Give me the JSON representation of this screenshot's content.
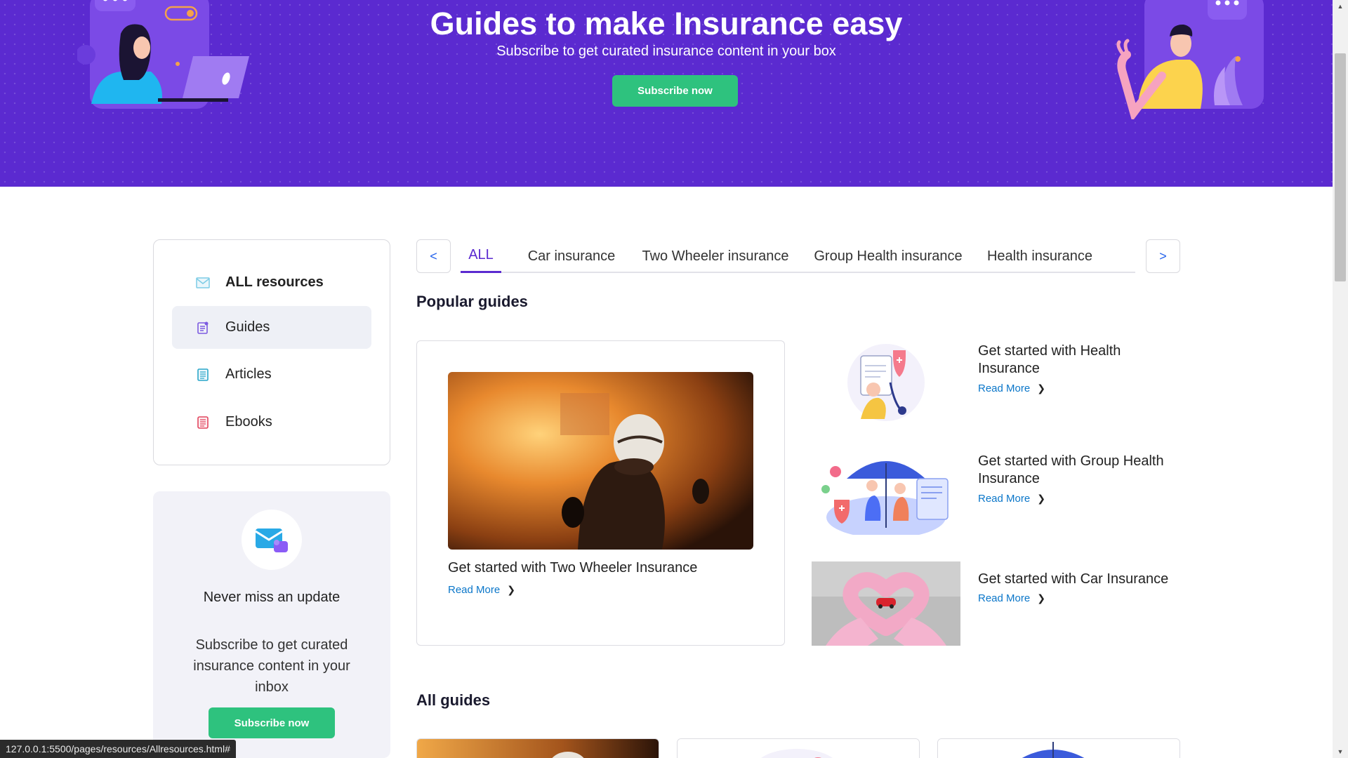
{
  "hero": {
    "title": "Guides to make Insurance easy",
    "subtitle": "Subscribe to get curated insurance content in your box",
    "subscribe_label": "Subscribe now"
  },
  "sidebar": {
    "items": [
      {
        "label": "ALL resources",
        "icon": "inbox-icon",
        "active": false
      },
      {
        "label": "Guides",
        "icon": "guide-icon",
        "active": true
      },
      {
        "label": "Articles",
        "icon": "article-icon",
        "active": false
      },
      {
        "label": "Ebooks",
        "icon": "ebook-icon",
        "active": false
      }
    ]
  },
  "subscribe_card": {
    "title": "Never miss an update",
    "text": "Subscribe to get curated insurance content in your inbox",
    "button_label": "Subscribe now"
  },
  "tabs": {
    "prev_label": "<",
    "next_label": ">",
    "items": [
      "ALL",
      "Car insurance",
      "Two Wheeler insurance",
      "Group Health insurance",
      "Health insurance"
    ],
    "active": "ALL"
  },
  "popular": {
    "heading": "Popular guides",
    "featured": {
      "title": "Get started with Two Wheeler Insurance",
      "read_more": "Read More"
    },
    "items": [
      {
        "title": "Get started with Health Insurance",
        "read_more": "Read More"
      },
      {
        "title": "Get started with Group Health Insurance",
        "read_more": "Read More"
      },
      {
        "title": "Get started with Car Insurance",
        "read_more": "Read More"
      }
    ]
  },
  "all_guides": {
    "heading": "All guides"
  },
  "status_bar": {
    "url": "127.0.0.1:5500/pages/resources/Allresources.html#"
  },
  "colors": {
    "brand_purple": "#5b2ad0",
    "accent_green": "#2ec27e",
    "link_blue": "#0a76c9"
  }
}
